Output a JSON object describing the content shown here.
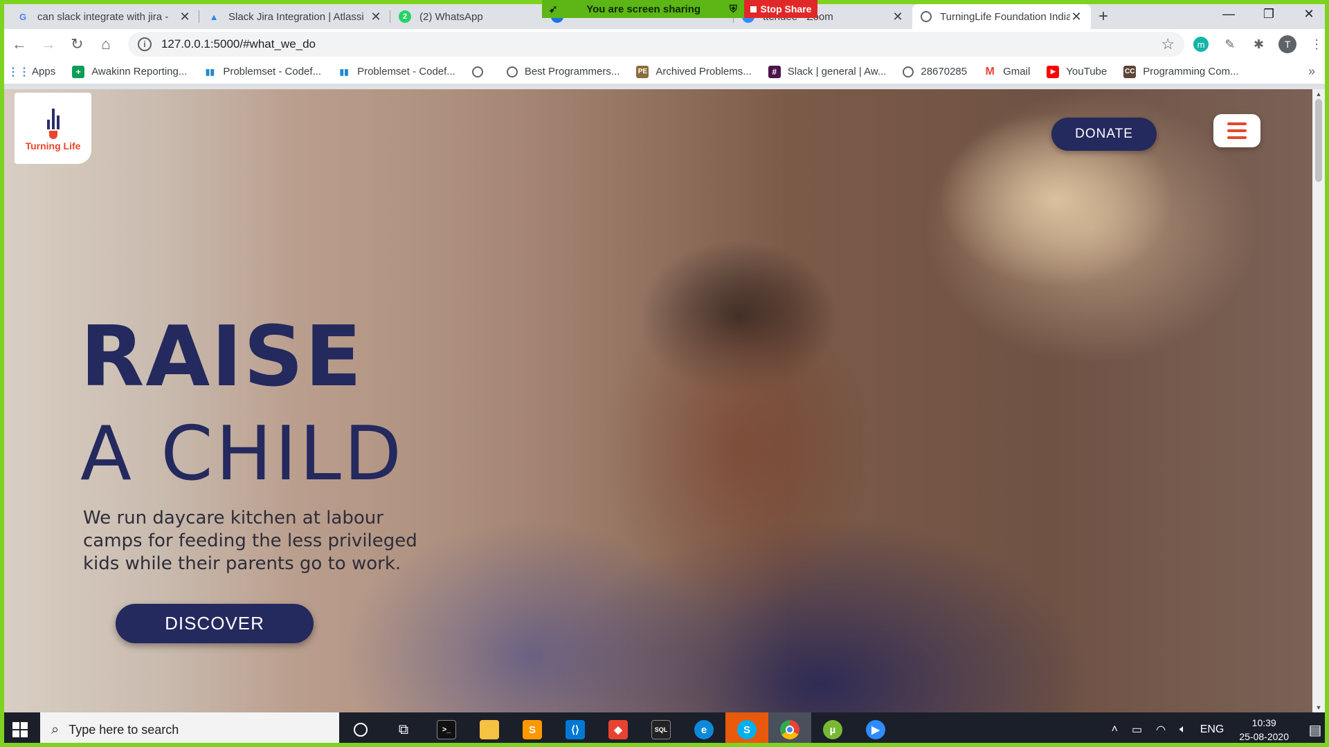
{
  "browser": {
    "tabs": [
      {
        "title": "can slack integrate with jira -",
        "favicon": "google-icon",
        "active": false
      },
      {
        "title": "Slack Jira Integration | Atlassi",
        "favicon": "atlassian-icon",
        "active": false
      },
      {
        "title": "(2) WhatsApp",
        "favicon": "whatsapp-icon",
        "badge": "2",
        "active": false
      },
      {
        "title": "",
        "favicon": "blue-app-icon",
        "active": false
      },
      {
        "title": "ttendee - Zoom",
        "favicon": "zoom-icon",
        "active": false
      },
      {
        "title": "TurningLife Foundation India",
        "favicon": "globe-icon",
        "active": true
      }
    ],
    "share_banner": {
      "text": "You are screen sharing",
      "stop_label": "Stop Share"
    },
    "url": "127.0.0.1:5000/#what_we_do",
    "profile_initial": "T",
    "extension_initial": "m",
    "bookmarks": [
      {
        "label": "Apps",
        "icon": "apps-grid-icon"
      },
      {
        "label": "Awakinn Reporting...",
        "icon": "sheets-icon"
      },
      {
        "label": "Problemset - Codef...",
        "icon": "codeforces-icon"
      },
      {
        "label": "Problemset - Codef...",
        "icon": "codeforces-icon"
      },
      {
        "label": "",
        "icon": "globe-icon"
      },
      {
        "label": "Best Programmers...",
        "icon": "globe-icon"
      },
      {
        "label": "Archived Problems...",
        "icon": "pe-icon"
      },
      {
        "label": "Slack | general | Aw...",
        "icon": "slack-icon"
      },
      {
        "label": "28670285",
        "icon": "globe-icon"
      },
      {
        "label": "Gmail",
        "icon": "gmail-icon"
      },
      {
        "label": "YouTube",
        "icon": "youtube-icon"
      },
      {
        "label": "Programming Com...",
        "icon": "cc-icon"
      }
    ]
  },
  "site": {
    "logo_text": "Turning Life",
    "donate_label": "DONATE",
    "headline_line1": "RAISE",
    "headline_line2": "A CHILD",
    "tagline": "We run daycare kitchen at labour camps for feeding the less privileged kids while their parents go to work.",
    "discover_label": "DISCOVER"
  },
  "taskbar": {
    "search_placeholder": "Type here to search",
    "apps": [
      "cortana-icon",
      "task-view-icon",
      "terminal-icon",
      "file-explorer-icon",
      "sublime-text-icon",
      "vscode-icon",
      "git-icon",
      "mysql-icon",
      "edge-icon",
      "skype-icon",
      "chrome-icon",
      "utorrent-icon",
      "zoom-icon"
    ],
    "language": "ENG",
    "time": "10:39",
    "date": "25-08-2020"
  },
  "colors": {
    "brand_navy": "#24295e",
    "brand_orange": "#e8452c",
    "share_green": "#7ed321",
    "stop_red": "#e02828"
  }
}
